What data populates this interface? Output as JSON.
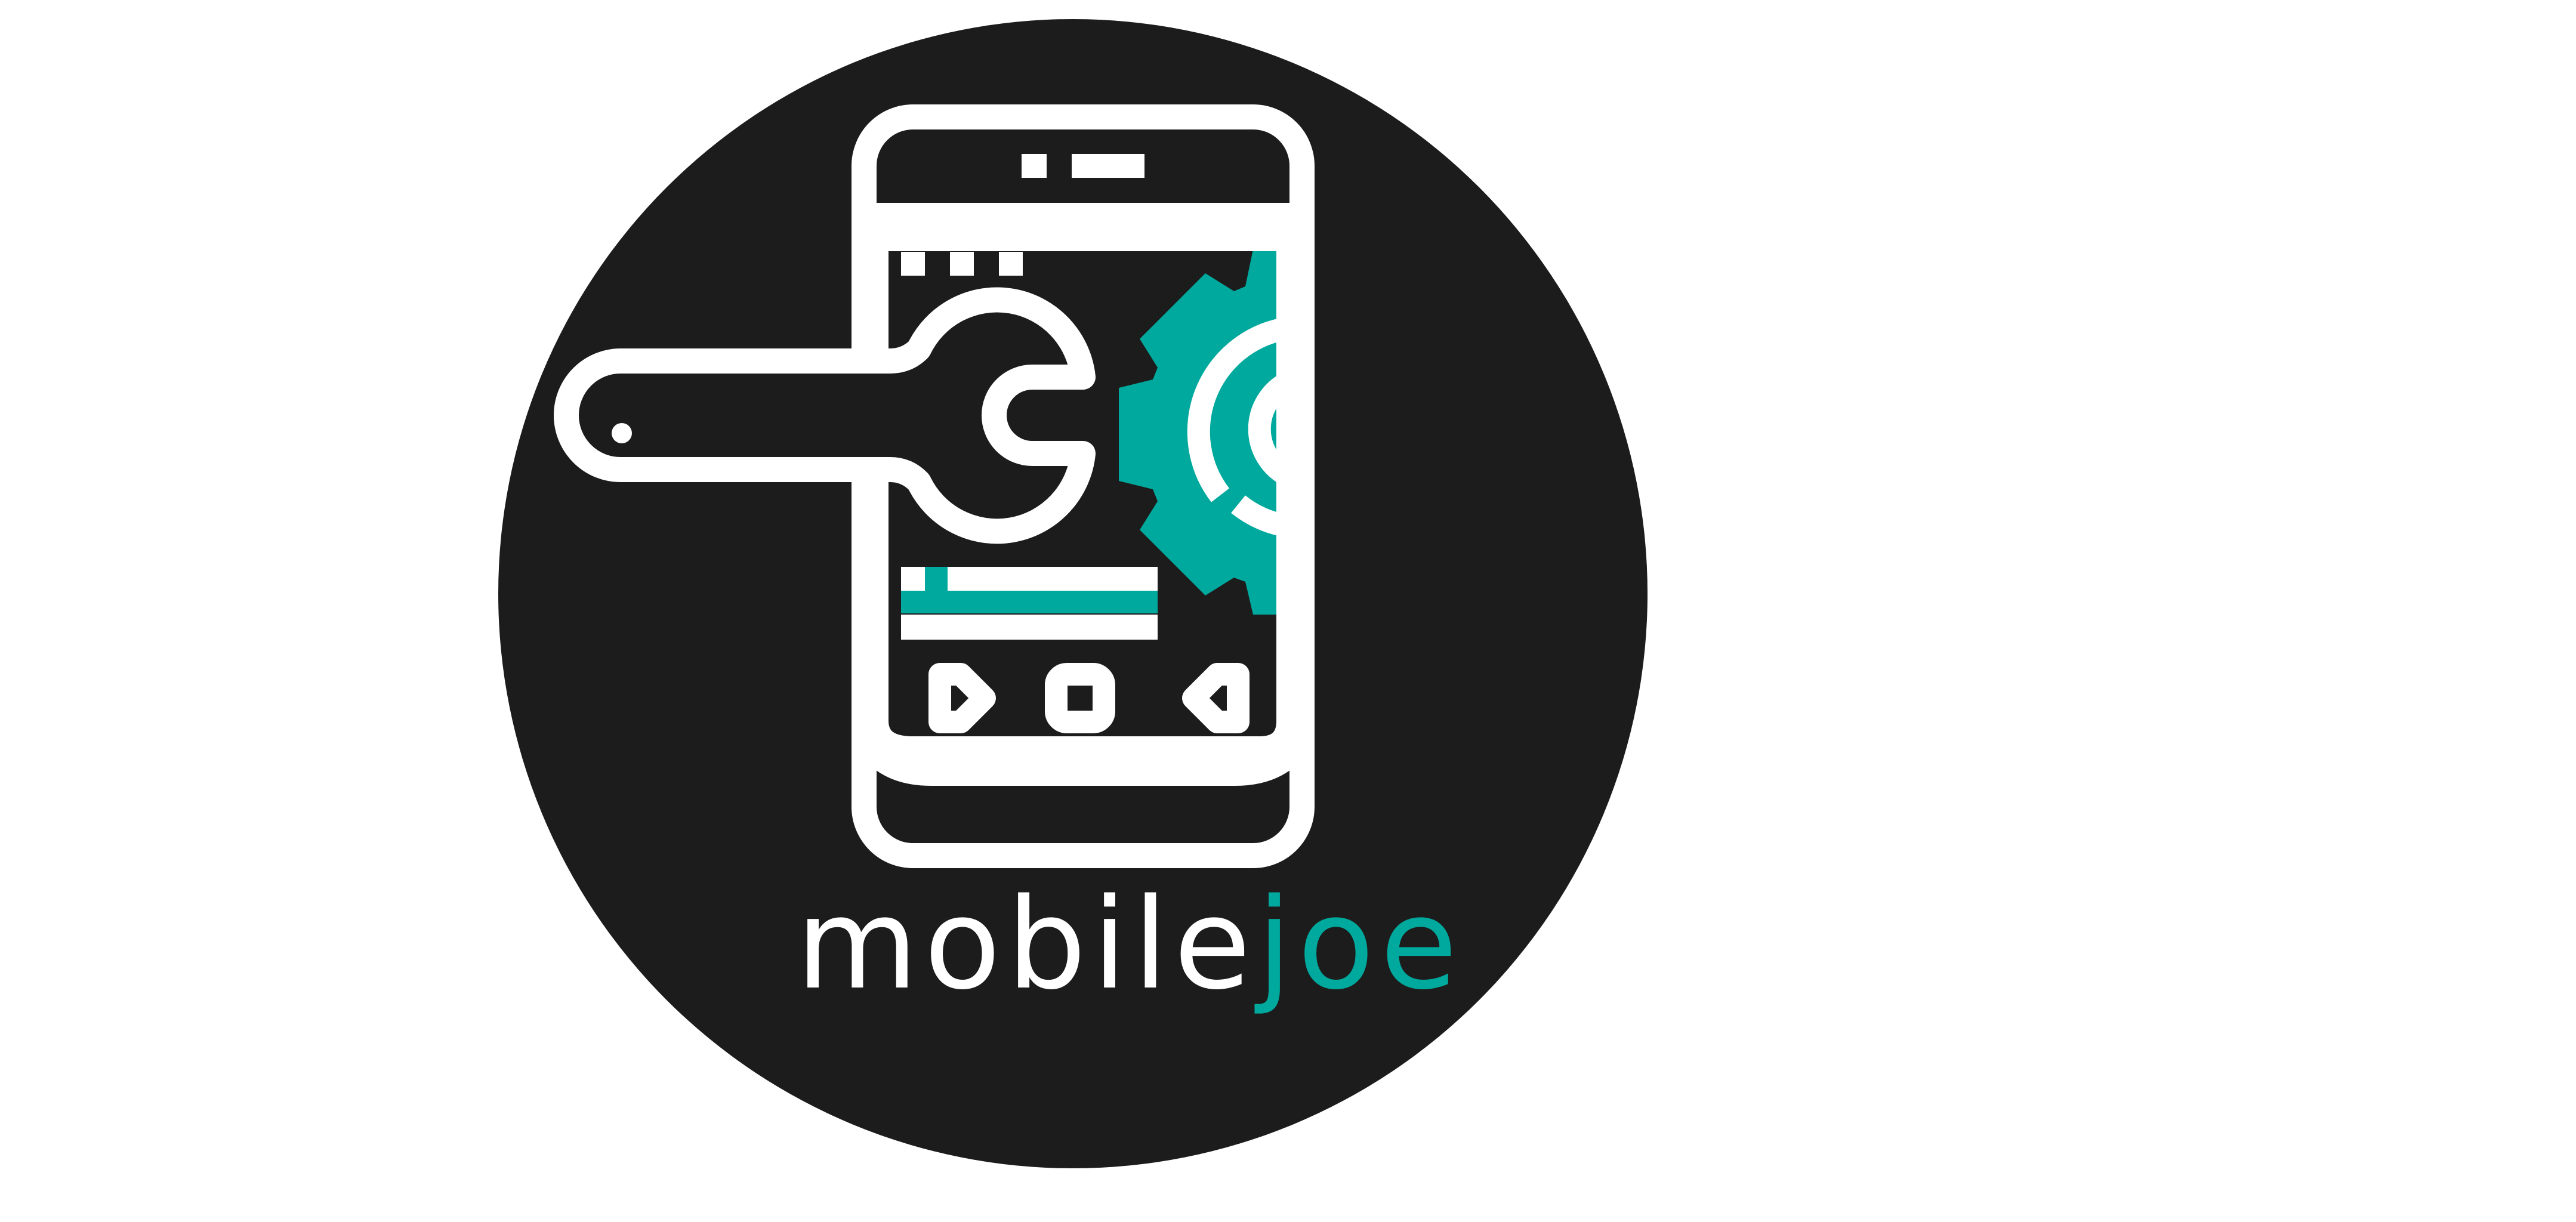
{
  "brand": {
    "name_primary": "mobile",
    "name_accent": "joe"
  },
  "colors": {
    "circle_background": "#1c1c1c",
    "line_art": "#ffffff",
    "accent": "#00a99d",
    "page_background": "#ffffff"
  },
  "icons": [
    "smartphone-icon",
    "wrench-icon",
    "gear-icon",
    "play-icon",
    "stop-icon",
    "back-icon"
  ]
}
